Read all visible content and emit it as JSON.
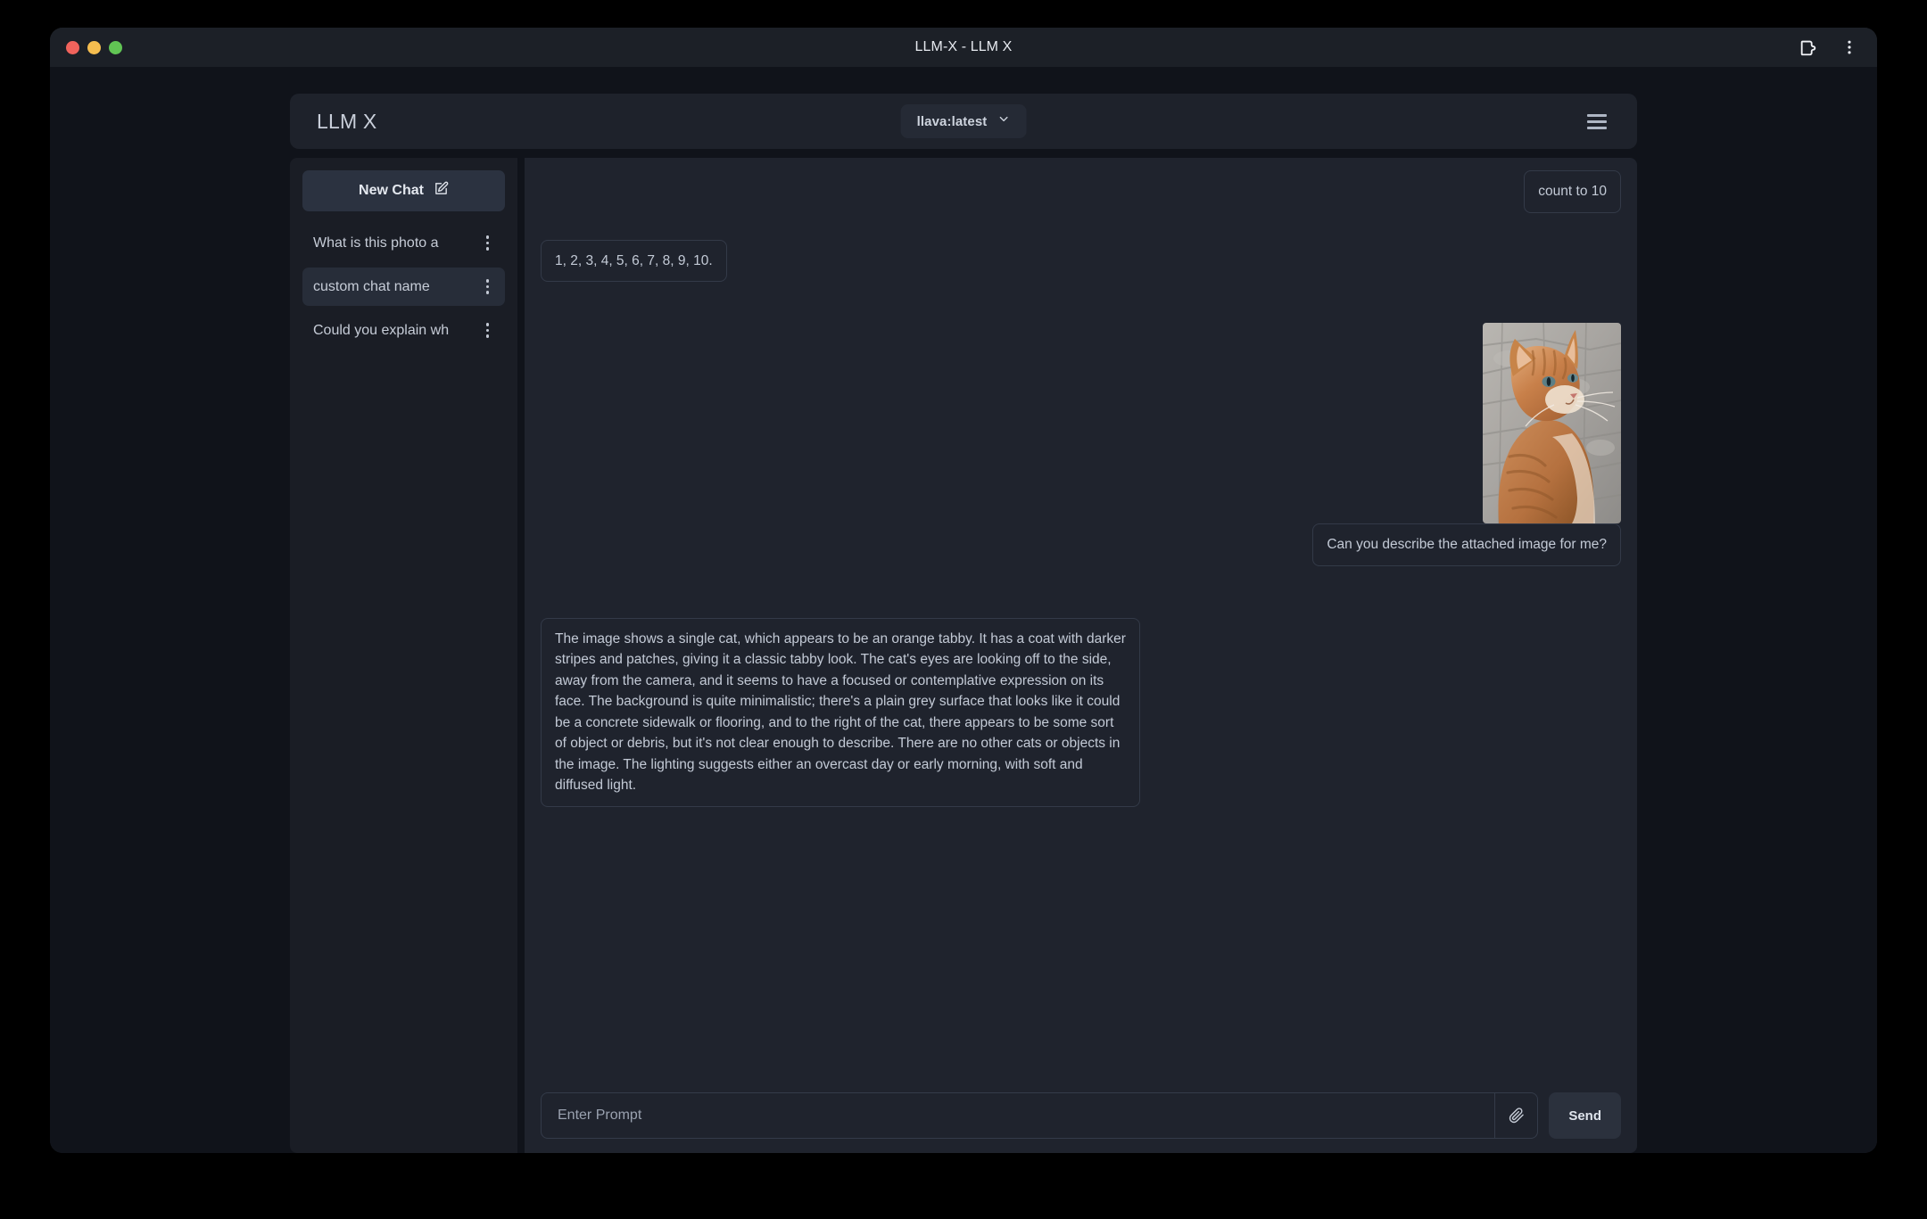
{
  "window": {
    "title": "LLM-X - LLM X",
    "traffic_lights": [
      "close",
      "minimize",
      "maximize"
    ],
    "toolbar_icons": [
      "extensions-icon",
      "browser-menu-icon"
    ]
  },
  "header": {
    "app_title": "LLM X",
    "model_selector": {
      "selected": "llava:latest",
      "icon": "chevron-down-icon"
    },
    "menu_icon": "hamburger-icon"
  },
  "sidebar": {
    "new_chat": {
      "label": "New Chat",
      "icon": "edit-square-icon"
    },
    "chats": [
      {
        "name": "What is this photo a",
        "selected": false,
        "menu_icon": "kebab-menu-icon"
      },
      {
        "name": "custom chat name",
        "selected": true,
        "menu_icon": "kebab-menu-icon"
      },
      {
        "name": "Could you explain wh",
        "selected": false,
        "menu_icon": "kebab-menu-icon"
      }
    ]
  },
  "messages": [
    {
      "role": "user",
      "text": "count to 10"
    },
    {
      "role": "assistant",
      "text": "1, 2, 3, 4, 5, 6, 7, 8, 9, 10."
    },
    {
      "role": "user",
      "attachment": "orange-tabby-cat-photo",
      "text": "Can you describe the attached image for me?"
    },
    {
      "role": "assistant",
      "text": "The image shows a single cat, which appears to be an orange tabby. It has a coat with darker stripes and patches, giving it a classic tabby look. The cat's eyes are looking off to the side, away from the camera, and it seems to have a focused or contemplative expression on its face. The background is quite minimalistic; there's a plain grey surface that looks like it could be a concrete sidewalk or flooring, and to the right of the cat, there appears to be some sort of object or debris, but it's not clear enough to describe. There are no other cats or objects in the image. The lighting suggests either an overcast day or early morning, with soft and diffused light."
    }
  ],
  "composer": {
    "placeholder": "Enter Prompt",
    "value": "",
    "attach_icon": "paperclip-icon",
    "send_label": "Send"
  },
  "colors": {
    "page_background": "#000000",
    "window_chrome": "#1c2027",
    "viewport_background": "#10131a",
    "header_background": "#1e222b",
    "sidebar_background": "#1a1d25",
    "chat_background": "#1f232d",
    "selected_item": "#272d39",
    "new_chat_button": "#2b3240",
    "bubble_border": "#333a48",
    "text_primary": "#c9cfda",
    "traffic_red": "#f0635c",
    "traffic_yellow": "#f5bd4f",
    "traffic_green": "#61c554"
  }
}
